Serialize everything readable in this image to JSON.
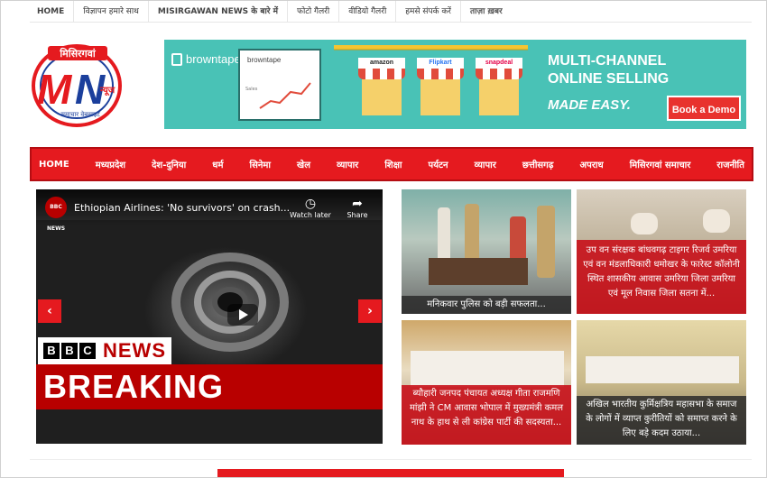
{
  "topbar": {
    "items": [
      "HOME",
      "विज्ञापन हमारे साथ",
      "MISIRGAWAN NEWS के बारे में",
      "फोटो गैलरी",
      "वीडियो गैलरी",
      "हमसे संपर्क करें",
      "ताज़ा ख़बर"
    ]
  },
  "logo": {
    "top_text": "मिसिरगवां",
    "letters": "MN",
    "side_text": "न्यूज",
    "tagline": "समाचार वेबसाइट",
    "colors": {
      "red": "#e51a1f",
      "blue": "#1b3f9c"
    }
  },
  "ad": {
    "brand": "browntape",
    "screen_brand": "browntape",
    "screen_label": "Sales",
    "stores": [
      "amazon",
      "Flipkart",
      "snapdeal"
    ],
    "headline_1": "MULTI-CHANNEL",
    "headline_2": "ONLINE SELLING",
    "subline": "MADE EASY.",
    "cta": "Book a Demo",
    "colors": {
      "bg": "#49c2b6",
      "cta": "#e8322e"
    }
  },
  "nav": {
    "items": [
      "HOME",
      "मध्यप्रदेश",
      "देश-दुनिया",
      "धर्म",
      "सिनेमा",
      "खेल",
      "व्यापार",
      "शिक्षा",
      "पर्यटन",
      "व्यापार",
      "छत्तीसगढ़",
      "अपराध",
      "मिसिरगवां समाचार",
      "राजनीति"
    ],
    "color": "#e51a1f"
  },
  "video": {
    "channel": "BBC NEWS",
    "title": "Ethiopian Airlines: 'No survivors' on crash...",
    "watch_later": "Watch later",
    "share": "Share",
    "bbc_letters": [
      "B",
      "B",
      "C"
    ],
    "news_word": "NEWS",
    "breaking": "BREAKING",
    "prev_icon": "chevron-left-icon",
    "next_icon": "chevron-right-icon"
  },
  "tiles": [
    {
      "caption": "मनिकवार पुलिस को बड़ी सफलता..."
    },
    {
      "caption": "उप वन संरक्षक बांधवगढ़ टाइगर रिजर्व उमरिया एवं वन मंडलाधिकारी धमोखर के फारेस्ट कॉलोनी स्थित शासकीय आवास उमरिया जिला उमरिया एवं मूल निवास जिला सतना में..."
    },
    {
      "caption": "ब्यौहारी जनपद पंचायत अध्यक्ष गीता राजमणि मांझी ने CM आवास भोपाल में मुख्यमंत्री कमल नाथ के हाथ से ली कांग्रेस पार्टी की सदस्यता..."
    },
    {
      "caption": "अखिल भारतीय कुर्मिक्षत्रिय महासभा के समाज के लोगों में व्याप्त कुरीतियों को समाप्त करने के लिए बड़े कदम उठाया..."
    }
  ]
}
